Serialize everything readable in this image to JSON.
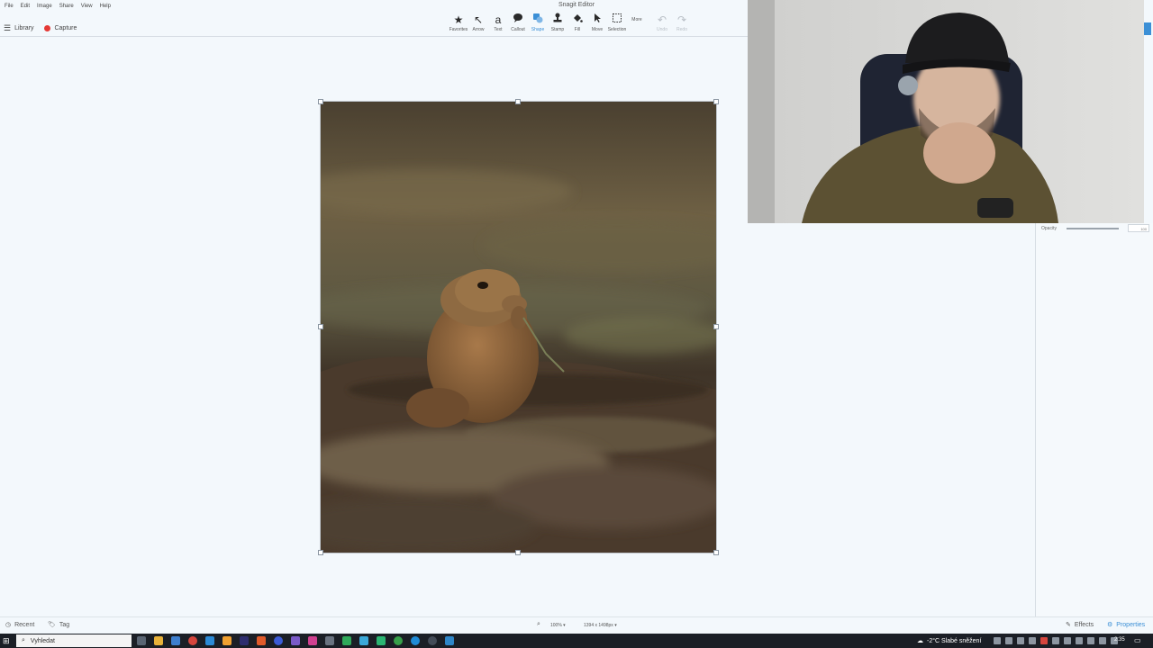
{
  "window": {
    "title": "Snagit Editor"
  },
  "menu": [
    "File",
    "Edit",
    "Image",
    "Share",
    "View",
    "Help"
  ],
  "toolbar": {
    "tools": [
      {
        "label": "Favorites",
        "icon": "star-icon"
      },
      {
        "label": "Arrow",
        "icon": "arrow-icon"
      },
      {
        "label": "Text",
        "icon": "text-icon"
      },
      {
        "label": "Callout",
        "icon": "callout-icon"
      },
      {
        "label": "Shape",
        "icon": "shape-icon",
        "active": true
      },
      {
        "label": "Stamp",
        "icon": "stamp-icon"
      },
      {
        "label": "Fill",
        "icon": "fill-icon"
      },
      {
        "label": "Move",
        "icon": "move-icon"
      },
      {
        "label": "Selection",
        "icon": "selection-icon"
      }
    ],
    "more_label": "More",
    "undo_label": "Undo",
    "redo_label": "Redo"
  },
  "subbar": {
    "library_label": "Library",
    "capture_label": "Capture"
  },
  "properties": {
    "opacity_label": "Opacity",
    "opacity_value": "100",
    "opacity_level": 1.0
  },
  "statusbar": {
    "recent_label": "Recent",
    "tag_label": "Tag",
    "zoom": "100% ▾",
    "dimensions": "1394 x 1498px ▾",
    "effects_label": "Effects",
    "properties_label": "Properties"
  },
  "taskbar": {
    "search_placeholder": "Vyhledat",
    "weather": "-2°C  Slabé sněžení",
    "time": "2:35"
  },
  "colors": {
    "accent": "#3b8fd6",
    "capture_dot": "#e53935",
    "taskbar": "#1b1f26"
  }
}
